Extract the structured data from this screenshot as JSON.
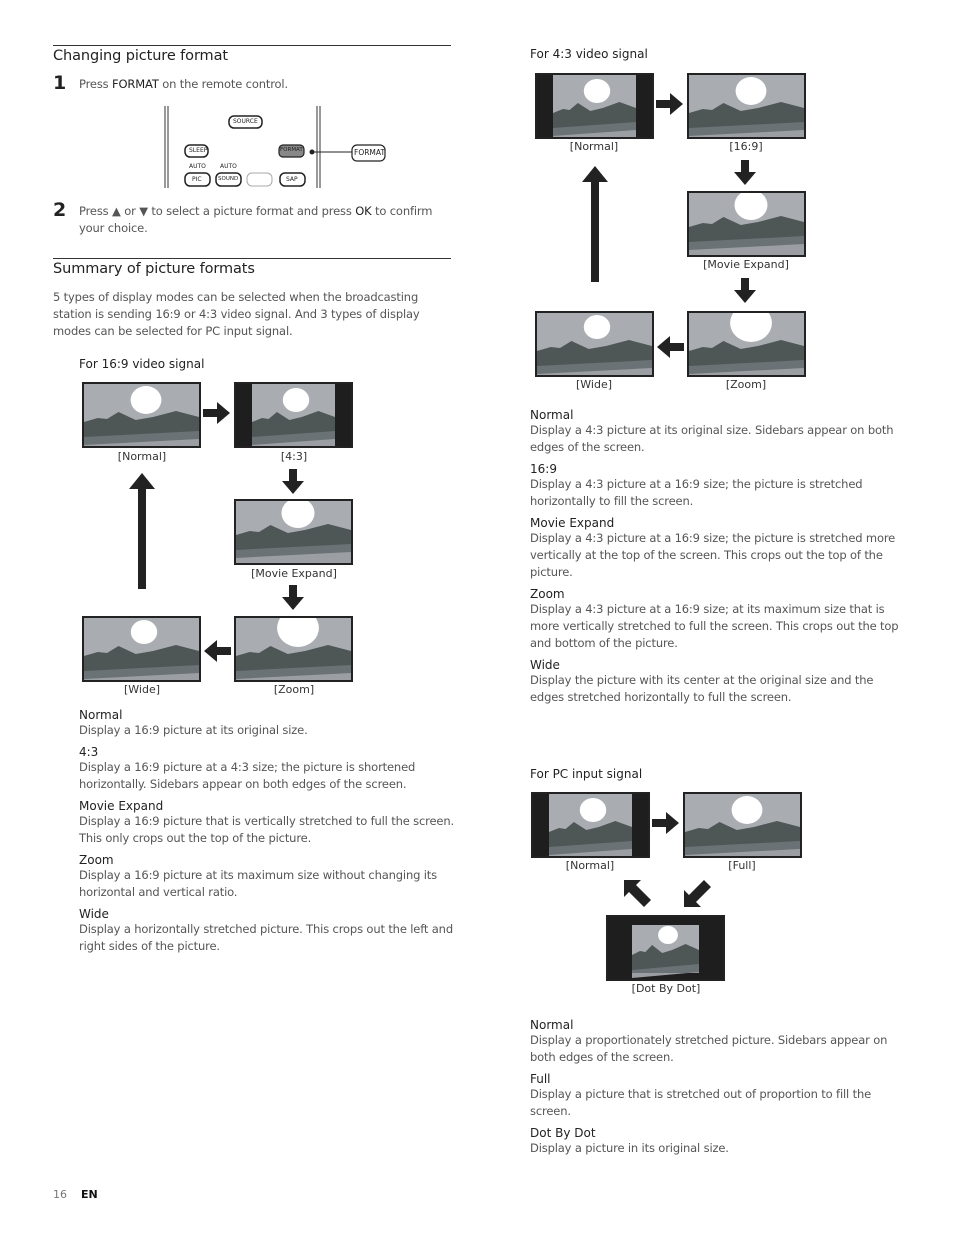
{
  "section1": {
    "title": "Changing picture format",
    "step1": {
      "num": "1",
      "pre": "Press ",
      "key": "FORMAT",
      "post": " on the remote control."
    },
    "remote": {
      "buttons": {
        "source": "SOURCE",
        "sleep": "SLEEP",
        "format": "FORMAT",
        "auto1": "AUTO",
        "pic": "PIC",
        "auto2": "AUTO",
        "sound": "SOUND",
        "sap": "SAP"
      },
      "callout": "FORMAT"
    },
    "step2": {
      "num": "2",
      "pre": "Press ▲ or ▼ to select a picture format and press ",
      "key": "OK",
      "post": " to confirm your choice."
    }
  },
  "section2": {
    "title": "Summary of picture formats",
    "intro": "5 types of display modes can be selected when the broadcasting station is sending 16:9 or 4:3 video signal. And 3 types of display modes can be selected for PC input signal."
  },
  "signal169": {
    "heading": "For 16:9 video signal",
    "captions": {
      "normal": "[Normal]",
      "r43": "[4:3]",
      "movie": "[Movie Expand]",
      "zoom": "[Zoom]",
      "wide": "[Wide]"
    },
    "descriptions": [
      {
        "term": "Normal",
        "text": "Display a 16:9 picture at its original size."
      },
      {
        "term": "4:3",
        "text": "Display a 16:9 picture at a 4:3 size; the picture is shortened horizontally. Sidebars appear on both edges of the screen."
      },
      {
        "term": "Movie Expand",
        "text": "Display a 16:9 picture that is vertically stretched to full the screen. This only crops out the top of the picture."
      },
      {
        "term": "Zoom",
        "text": "Display a 16:9 picture at its maximum size without changing its horizontal and vertical ratio."
      },
      {
        "term": "Wide",
        "text": "Display a horizontally stretched picture. This crops out the left and right sides of the picture."
      }
    ]
  },
  "signal43": {
    "heading": "For 4:3 video signal",
    "captions": {
      "normal": "[Normal]",
      "r169": "[16:9]",
      "movie": "[Movie Expand]",
      "zoom": "[Zoom]",
      "wide": "[Wide]"
    },
    "descriptions": [
      {
        "term": "Normal",
        "text": "Display a 4:3 picture at its original size. Sidebars appear on both edges of the screen."
      },
      {
        "term": "16:9",
        "text": "Display a 4:3 picture at a 16:9 size; the picture is stretched horizontally to fill the screen."
      },
      {
        "term": "Movie Expand",
        "text": "Display a 4:3 picture at a 16:9 size; the picture is stretched more vertically at the top of the screen. This crops out the top of the picture."
      },
      {
        "term": "Zoom",
        "text": "Display a 4:3 picture at a 16:9 size; at its maximum size that is more vertically stretched to full the screen. This crops out the top and bottom of the picture."
      },
      {
        "term": "Wide",
        "text": "Display the picture with its center at the original size and the edges stretched horizontally to full the screen."
      }
    ]
  },
  "signalPC": {
    "heading": "For PC input signal",
    "captions": {
      "normal": "[Normal]",
      "full": "[Full]",
      "dot": "[Dot By Dot]"
    },
    "descriptions": [
      {
        "term": "Normal",
        "text": "Display a proportionately stretched picture. Sidebars appear on both edges of the screen."
      },
      {
        "term": "Full",
        "text": "Display a picture that is stretched out of proportion to fill the screen."
      },
      {
        "term": "Dot By Dot",
        "text": "Display a picture in its original size."
      }
    ]
  },
  "footer": {
    "page": "16",
    "lang": "EN"
  }
}
